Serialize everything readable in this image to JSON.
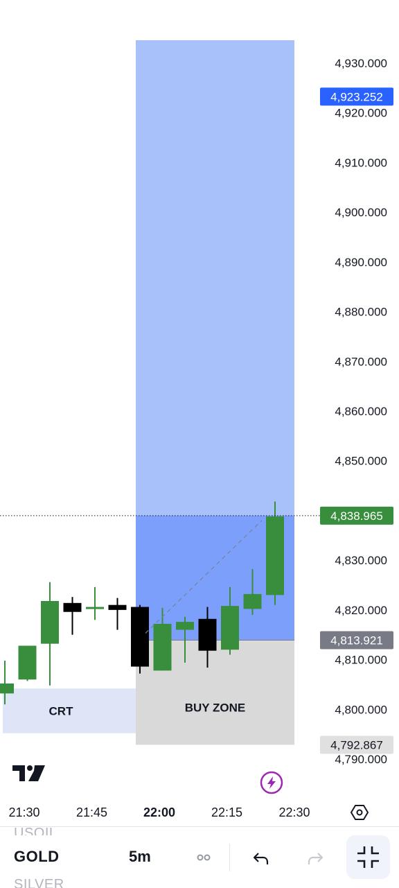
{
  "chart_data": {
    "type": "candlestick",
    "price_axis": {
      "ylim": [
        4788.6,
        4935.7
      ],
      "ticks": [
        "4,930.000",
        "4,920.000",
        "4,910.000",
        "4,900.000",
        "4,890.000",
        "4,880.000",
        "4,870.000",
        "4,860.000",
        "4,850.000",
        "4,840.000",
        "4,830.000",
        "4,820.000",
        "4,810.000",
        "4,800.000",
        "4,790.000"
      ],
      "tick_values": [
        4930,
        4920,
        4910,
        4900,
        4890,
        4880,
        4870,
        4860,
        4850,
        4840,
        4830,
        4820,
        4810,
        4800,
        4790
      ]
    },
    "time_axis": {
      "labels": [
        "21:30",
        "21:45",
        "22:00",
        "22:15",
        "22:30"
      ],
      "bold_label": "22:00",
      "interval_minutes": 5
    },
    "candles": [
      {
        "time": "21:20",
        "open": 4803.2,
        "high": 4809.8,
        "low": 4801.0,
        "close": 4805.2
      },
      {
        "time": "21:25",
        "open": 4806.0,
        "high": 4812.2,
        "low": 4805.7,
        "close": 4812.8
      },
      {
        "time": "21:30",
        "open": 4813.2,
        "high": 4825.6,
        "low": 4804.8,
        "close": 4821.8
      },
      {
        "time": "21:35",
        "open": 4821.4,
        "high": 4822.6,
        "low": 4815.0,
        "close": 4819.6
      },
      {
        "time": "21:40",
        "open": 4820.2,
        "high": 4824.6,
        "low": 4818.0,
        "close": 4820.6
      },
      {
        "time": "21:45",
        "open": 4821.0,
        "high": 4822.4,
        "low": 4816.0,
        "close": 4820.0
      },
      {
        "time": "21:50",
        "open": 4820.6,
        "high": 4821.0,
        "low": 4807.2,
        "close": 4808.6
      },
      {
        "time": "21:55",
        "open": 4807.8,
        "high": 4820.4,
        "low": 4807.8,
        "close": 4817.2
      },
      {
        "time": "22:00",
        "open": 4816.0,
        "high": 4818.6,
        "low": 4809.4,
        "close": 4817.6
      },
      {
        "time": "22:05",
        "open": 4818.2,
        "high": 4820.6,
        "low": 4808.4,
        "close": 4811.8
      },
      {
        "time": "22:10",
        "open": 4812.0,
        "high": 4824.6,
        "low": 4811.0,
        "close": 4820.8
      },
      {
        "time": "22:15",
        "open": 4820.2,
        "high": 4828.2,
        "low": 4819.0,
        "close": 4823.2
      },
      {
        "time": "22:20",
        "open": 4823.0,
        "high": 4841.8,
        "low": 4821.0,
        "close": 4838.8
      }
    ],
    "position_tool": {
      "label": "BUY ZONE",
      "entry": 4813.921,
      "target": 4935.7,
      "stop": 4792.867
    },
    "crt_box": {
      "label": "CRT",
      "top": 4804.2,
      "bottom": 4795.2
    },
    "price_tags": [
      {
        "value": "4,923.252",
        "price": 4923.252,
        "color": "#2962ff",
        "text_color": "#ffffff"
      },
      {
        "value": "4,838.965",
        "price": 4838.965,
        "color": "#388e3c",
        "text_color": "#ffffff"
      },
      {
        "value": "4,813.921",
        "price": 4813.921,
        "color": "#787b86",
        "text_color": "#ffffff"
      },
      {
        "value": "4,792.867",
        "price": 4792.867,
        "color": "#e0e0e0",
        "text_color": "#131722"
      }
    ],
    "current_price_line": 4838.965,
    "colors": {
      "up": "#388e3c",
      "down": "#000000",
      "profit_zone": "#a8c1fb",
      "profit_zone_overlap": "#7b9ffb",
      "stop_zone": "#d9d9d9",
      "crt_zone": "#dde5f7"
    }
  },
  "toolbar": {
    "symbol_prev": "USOIL",
    "symbol_current": "GOLD",
    "symbol_next": "SILVER",
    "interval": "5m"
  },
  "icons": {
    "logo": "tradingview-logo",
    "flash": "lightning-icon",
    "settings": "settings-hexagon-icon",
    "indicators": "indicators-icon",
    "undo": "undo-icon",
    "redo": "redo-icon",
    "fullscreen": "exit-fullscreen-icon"
  }
}
